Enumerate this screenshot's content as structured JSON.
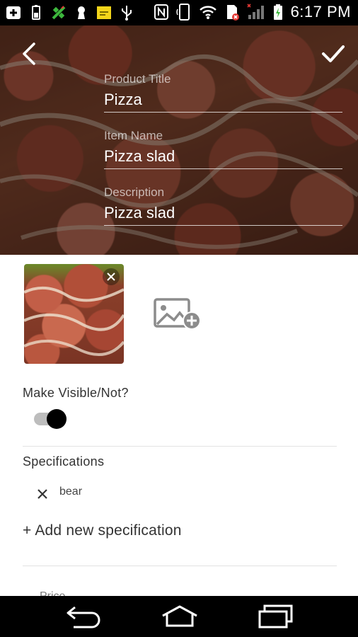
{
  "status_bar": {
    "time": "6:17 PM",
    "left_icons": [
      "add-box-icon",
      "battery-saver-icon",
      "satellite-icon",
      "keyhole-icon",
      "sticky-note-icon",
      "usb-icon"
    ],
    "right_icons": [
      "nfc-icon",
      "phone-rotate-icon",
      "wifi-icon",
      "sim-error-icon",
      "signal-icon",
      "battery-charging-icon"
    ]
  },
  "header": {
    "back_icon": "chevron-left-icon",
    "confirm_icon": "check-icon"
  },
  "form": {
    "product_title": {
      "label": "Product Title",
      "value": "Pizza"
    },
    "item_name": {
      "label": "Item Name",
      "value": "Pizza slad"
    },
    "description": {
      "label": "Description",
      "value": "Pizza slad"
    }
  },
  "photos": {
    "remove_icon": "close-icon",
    "add_icon": "add-photo-icon"
  },
  "visibility": {
    "label": "Make Visible/Not?",
    "enabled": true
  },
  "specifications": {
    "title": "Specifications",
    "items": [
      {
        "label": "bear"
      }
    ],
    "add_label": "+ Add new specification"
  },
  "price": {
    "label": "Price"
  },
  "nav_bar": {
    "icons": [
      "back-icon",
      "home-icon",
      "recent-apps-icon"
    ]
  }
}
